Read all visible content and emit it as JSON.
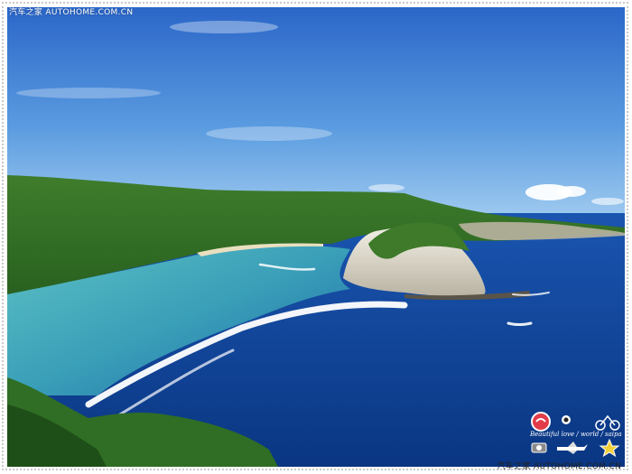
{
  "watermark": {
    "top_left": "汽车之家 AUTOHOME.COM.CN",
    "bottom_right": "汽车之家 AUTOHOME.COM.CN"
  },
  "stickers": {
    "script_text": "Beautiful  love / world / saipan",
    "icons": [
      "heart-badge-icon",
      "character-icon",
      "scooter-icon",
      "camera-icon",
      "airplane-icon",
      "star-icon"
    ]
  },
  "colors": {
    "sky_top": "#2f6fcf",
    "sky_bottom": "#8fc3ee",
    "ocean_deep": "#0b3c8a",
    "lagoon": "#4fb3c2",
    "foliage": "#2e6b25",
    "cliff": "#e8e4d6",
    "surf": "#ffffff"
  }
}
